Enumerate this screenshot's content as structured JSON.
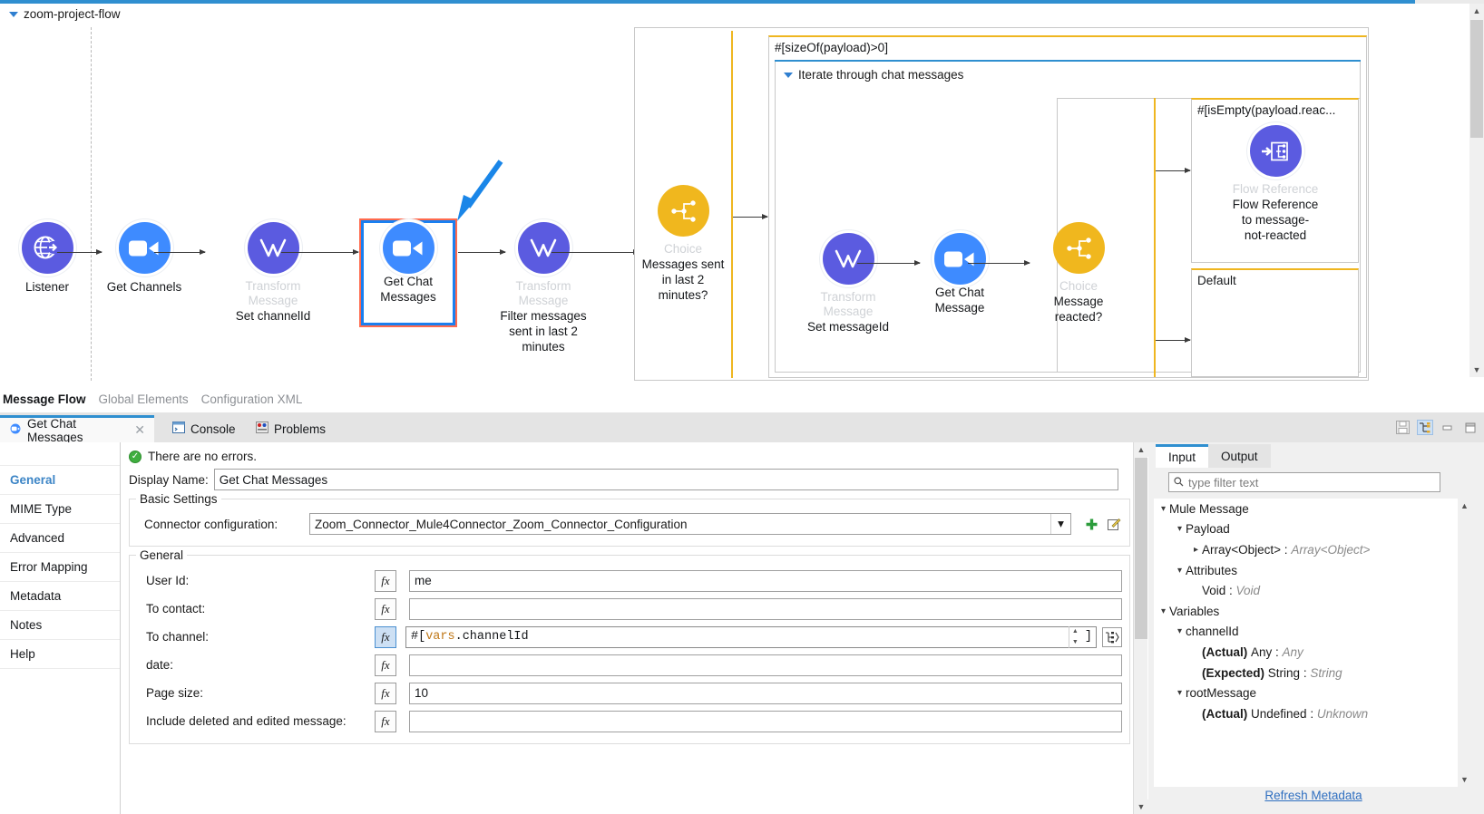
{
  "flow": {
    "title": "zoom-project-flow",
    "nodes": [
      {
        "name": "listener",
        "type": "",
        "label": "Listener",
        "icon": "globe-arrow-icon",
        "color": "#5b5be0"
      },
      {
        "name": "get-channels",
        "type": "",
        "label": "Get Channels",
        "icon": "zoom-camera-icon",
        "color": "#3e8bff"
      },
      {
        "name": "transform-set-channelid",
        "type": "Transform Message",
        "label": "Set channelId",
        "icon": "dataweave-icon",
        "color": "#5b5be0"
      },
      {
        "name": "get-chat-messages",
        "type": "",
        "label_line1": "Get Chat",
        "label_line2": "Messages",
        "icon": "zoom-camera-icon",
        "color": "#3e8bff",
        "selected": true
      },
      {
        "name": "transform-filter-messages",
        "type": "Transform Message",
        "label_line1": "Filter messages",
        "label_line2": "sent in last 2",
        "label_line3": "minutes",
        "icon": "dataweave-icon",
        "color": "#5b5be0"
      },
      {
        "name": "choice-messages-sent",
        "type": "Choice",
        "label_line1": "Messages sent",
        "label_line2": "in last 2",
        "label_line3": "minutes?",
        "icon": "choice-icon",
        "color": "#f0b71e"
      },
      {
        "name": "transform-set-messageid",
        "type": "Transform Message",
        "label": "Set messageId",
        "icon": "dataweave-icon",
        "color": "#5b5be0"
      },
      {
        "name": "get-chat-message",
        "type": "",
        "label_line1": "Get Chat",
        "label_line2": "Message",
        "icon": "zoom-camera-icon",
        "color": "#3e8bff"
      },
      {
        "name": "choice-message-reacted",
        "type": "Choice",
        "label_line1": "Message",
        "label_line2": "reacted?",
        "icon": "choice-icon",
        "color": "#f0b71e"
      },
      {
        "name": "flow-reference",
        "type": "Flow Reference",
        "label_line1": "Flow Reference",
        "label_line2": "to message-",
        "label_line3": "not-reacted",
        "icon": "flow-reference-icon",
        "color": "#5b5be0"
      }
    ],
    "scopes": {
      "when_condition": "#[sizeOf(payload)>0]",
      "foreach_title": "Iterate through chat messages",
      "inner_condition": "#[isEmpty(payload.reac...",
      "default_label": "Default"
    },
    "accent_selection": "#1a7ff0",
    "accent_scope": "#efb620"
  },
  "editor_tabs": [
    {
      "label": "Message Flow",
      "active": true
    },
    {
      "label": "Global Elements",
      "active": false
    },
    {
      "label": "Configuration XML",
      "active": false
    }
  ],
  "bottom_panel": {
    "tabs": [
      {
        "label": "Get Chat Messages",
        "icon": "zoom-camera-icon",
        "active": true,
        "closable": true
      },
      {
        "label": "Console",
        "icon": "console-icon",
        "active": false
      },
      {
        "label": "Problems",
        "icon": "problems-icon",
        "active": false
      }
    ],
    "tools": [
      {
        "name": "save-icon",
        "glyph": "💾",
        "selected": false
      },
      {
        "name": "link-tree-icon",
        "glyph": "⇲",
        "selected": true
      },
      {
        "name": "minimize-icon",
        "glyph": "–",
        "selected": false
      },
      {
        "name": "maximize-icon",
        "glyph": "□",
        "selected": false
      }
    ]
  },
  "prop_nav": [
    {
      "label": "General",
      "active": true
    },
    {
      "label": "MIME Type",
      "active": false
    },
    {
      "label": "Advanced",
      "active": false
    },
    {
      "label": "Error Mapping",
      "active": false
    },
    {
      "label": "Metadata",
      "active": false
    },
    {
      "label": "Notes",
      "active": false
    },
    {
      "label": "Help",
      "active": false
    }
  ],
  "form": {
    "status": "There are no errors.",
    "display_name_label": "Display Name:",
    "display_name_value": "Get Chat Messages",
    "basic_settings_legend": "Basic Settings",
    "connector_label": "Connector configuration:",
    "connector_value": "Zoom_Connector_Mule4Connector_Zoom_Connector_Configuration",
    "general_legend": "General",
    "fields": [
      {
        "label": "User Id:",
        "value": "me",
        "fx_active": false,
        "expression": false
      },
      {
        "label": "To contact:",
        "value": "",
        "fx_active": false,
        "expression": false
      },
      {
        "label": "To channel:",
        "value": "#[ vars.channelId",
        "fx_active": true,
        "expression": true,
        "expr_prefix": "#[ ",
        "expr_kw": "vars",
        "expr_rest": ".channelId",
        "expr_suffix": "]"
      },
      {
        "label": "date:",
        "value": "",
        "fx_active": false,
        "expression": false
      },
      {
        "label": "Page size:",
        "value": "10",
        "fx_active": false,
        "expression": false
      },
      {
        "label": "Include deleted and edited message:",
        "value": "",
        "fx_active": false,
        "expression": false
      }
    ]
  },
  "metadata": {
    "tabs": [
      {
        "label": "Input",
        "active": true
      },
      {
        "label": "Output",
        "active": false
      }
    ],
    "filter_placeholder": "type filter text",
    "tree": [
      {
        "indent": 0,
        "chev": "v",
        "label": "Mule Message",
        "type": ""
      },
      {
        "indent": 1,
        "chev": "v",
        "label": "Payload",
        "type": ""
      },
      {
        "indent": 2,
        "chev": ">",
        "label": "Array<Object>",
        "type": "Array<Object>"
      },
      {
        "indent": 1,
        "chev": "v",
        "label": "Attributes",
        "type": ""
      },
      {
        "indent": 2,
        "chev": "",
        "label": "Void",
        "type": "Void"
      },
      {
        "indent": 0,
        "chev": "v",
        "label": "Variables",
        "type": ""
      },
      {
        "indent": 1,
        "chev": "v",
        "label": "channelId",
        "type": ""
      },
      {
        "indent": 2,
        "chev": "",
        "prefix": "(Actual)",
        "label": "Any",
        "type": "Any"
      },
      {
        "indent": 2,
        "chev": "",
        "prefix": "(Expected)",
        "label": "String",
        "type": "String"
      },
      {
        "indent": 1,
        "chev": "v",
        "label": "rootMessage",
        "type": ""
      },
      {
        "indent": 2,
        "chev": "",
        "prefix": "(Actual)",
        "label": "Undefined",
        "type": "Unknown"
      }
    ],
    "refresh_label": "Refresh Metadata"
  }
}
